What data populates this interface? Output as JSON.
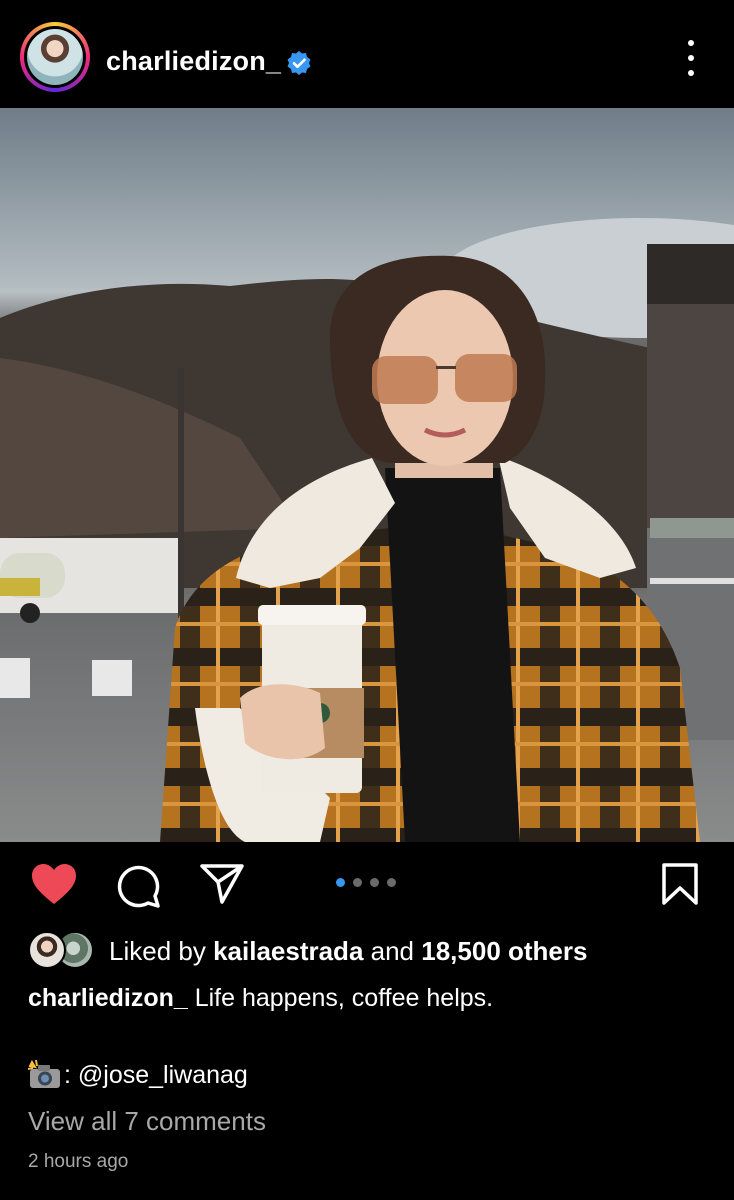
{
  "header": {
    "username": "charliedizon_",
    "verified_icon": "verified-badge-icon",
    "more_icon": "more-vertical-icon"
  },
  "post": {
    "carousel": {
      "total": 4,
      "active": 1
    },
    "actions": {
      "like_icon": "heart-filled-icon",
      "comment_icon": "comment-icon",
      "share_icon": "send-icon",
      "save_icon": "bookmark-icon"
    },
    "likes": {
      "prefix": "Liked by",
      "user": "kailaestrada",
      "and": "and",
      "others": "18,500 others"
    },
    "caption": {
      "username": "charliedizon_",
      "text": "Life happens, coffee helps."
    },
    "credit": {
      "emoji_icon": "camera-flash-icon",
      "text": ": @jose_liwanag"
    },
    "view_comments": "View all 7 comments",
    "timestamp": "2 hours ago"
  },
  "colors": {
    "background": "#000000",
    "like_red": "#ed4956",
    "verified_blue": "#3897f0",
    "muted_text": "#a8a8a8"
  }
}
